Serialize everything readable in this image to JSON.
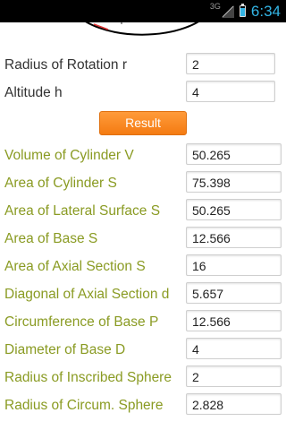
{
  "status_bar": {
    "network": "3G",
    "time": "6:34"
  },
  "inputs": [
    {
      "label": "Radius of Rotation r",
      "value": "2"
    },
    {
      "label": "Altitude h",
      "value": "4"
    }
  ],
  "result_button": "Result",
  "outputs": [
    {
      "label": "Volume of Cylinder V",
      "value": "50.265"
    },
    {
      "label": "Area of Cylinder S",
      "value": "75.398"
    },
    {
      "label": "Area of Lateral Surface S",
      "value": "50.265"
    },
    {
      "label": "Area of Base S",
      "value": "12.566"
    },
    {
      "label": "Area of Axial Section S",
      "value": "16"
    },
    {
      "label": "Diagonal of Axial Section d",
      "value": "5.657"
    },
    {
      "label": "Circumference of Base P",
      "value": "12.566"
    },
    {
      "label": "Diameter of Base D",
      "value": "4"
    },
    {
      "label": "Radius of Inscribed Sphere",
      "value": "2"
    },
    {
      "label": "Radius of Circum. Sphere",
      "value": "2.828"
    }
  ],
  "colors": {
    "input_label": "#333333",
    "output_label": "#8a9b23",
    "button": "#f47b12",
    "status_accent": "#33b5e5"
  }
}
